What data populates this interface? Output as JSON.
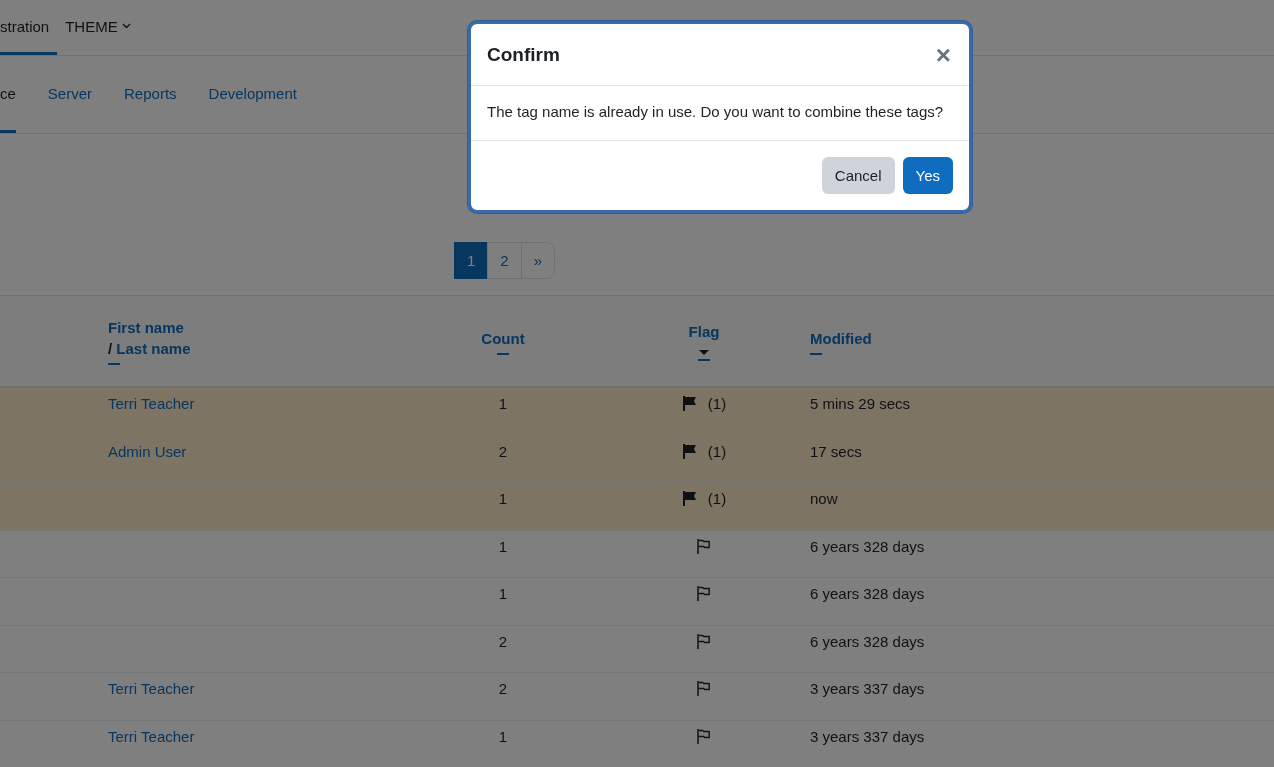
{
  "primary_nav": [
    {
      "label": "stration",
      "selected": true,
      "kind": "link"
    },
    {
      "label": "THEME",
      "selected": false,
      "kind": "dropdown"
    }
  ],
  "secondary_nav": [
    {
      "label": "ce",
      "selected": true
    },
    {
      "label": "Server",
      "selected": false
    },
    {
      "label": "Reports",
      "selected": false
    },
    {
      "label": "Development",
      "selected": false
    }
  ],
  "pagination": [
    {
      "label": "1",
      "selected": true
    },
    {
      "label": "2",
      "selected": false
    },
    {
      "label": "»",
      "selected": false
    }
  ],
  "table": {
    "columns": [
      {
        "kind": "name",
        "first": "First name",
        "separator": "/",
        "last": "Last name",
        "sorted": false
      },
      {
        "kind": "center",
        "label": "Count",
        "sorted": false
      },
      {
        "kind": "center",
        "label": "Flag",
        "sorted": true
      },
      {
        "kind": "text",
        "label": "Modified",
        "sorted": false
      }
    ],
    "rows": [
      {
        "name": "Terri Teacher",
        "count": "1",
        "flagged": true,
        "flag_count": "(1)",
        "modified": "5 mins 29 secs"
      },
      {
        "name": "Admin User",
        "count": "2",
        "flagged": true,
        "flag_count": "(1)",
        "modified": "17 secs"
      },
      {
        "count": "1",
        "flagged": true,
        "flag_count": "(1)",
        "modified": "now"
      },
      {
        "count": "1",
        "flagged": false,
        "modified": "6 years 328 days"
      },
      {
        "count": "1",
        "flagged": false,
        "modified": "6 years 328 days"
      },
      {
        "count": "2",
        "flagged": false,
        "modified": "6 years 328 days"
      },
      {
        "name": "Terri Teacher",
        "count": "2",
        "flagged": false,
        "modified": "3 years 337 days"
      },
      {
        "name": "Terri Teacher",
        "count": "1",
        "flagged": false,
        "modified": "3 years 337 days"
      }
    ]
  },
  "dialog": {
    "title": "Confirm",
    "close": "×",
    "message": "The tag name is already in use. Do you want to combine these tags?",
    "buttons": [
      {
        "label": "Cancel",
        "kind": "secondary"
      },
      {
        "label": "Yes",
        "kind": "primary"
      }
    ]
  }
}
